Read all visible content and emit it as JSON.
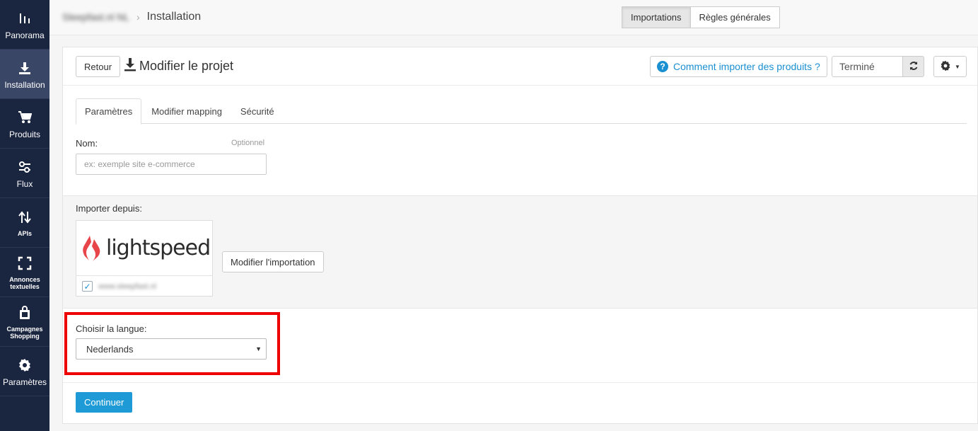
{
  "sidebar": {
    "items": [
      {
        "label": "Panorama",
        "icon": "bar-chart-icon"
      },
      {
        "label": "Installation",
        "icon": "download-icon"
      },
      {
        "label": "Produits",
        "icon": "cart-icon"
      },
      {
        "label": "Flux",
        "icon": "sliders-icon"
      },
      {
        "label": "APIs",
        "icon": "arrows-updown-icon"
      },
      {
        "label": "Annonces textuelles",
        "icon": "expand-icon"
      },
      {
        "label": "Campagnes Shopping",
        "icon": "shopping-bag-icon"
      },
      {
        "label": "Paramètres",
        "icon": "gear-icon"
      }
    ]
  },
  "topbar": {
    "store_name": "Sleepfast.nl NL",
    "page_title": "Installation",
    "segments": [
      "Importations",
      "Règles générales"
    ]
  },
  "header": {
    "back_label": "Retour",
    "title": "Modifier le projet",
    "help_label": "Comment importer des produits ?",
    "status_value": "Terminé"
  },
  "tabs": [
    "Paramètres",
    "Modifier mapping",
    "Sécurité"
  ],
  "form": {
    "name_label": "Nom:",
    "optional_label": "Optionnel",
    "name_placeholder": "ex: exemple site e-commerce"
  },
  "import": {
    "label": "Importer depuis:",
    "source_logo": "lightspeed",
    "source_url": "www.sleepfast.nl",
    "modify_label": "Modifier l'importation"
  },
  "language": {
    "label": "Choisir la langue:",
    "selected": "Nederlands"
  },
  "continue_label": "Continuer",
  "colors": {
    "sidebar_bg": "#1a2540",
    "accent": "#1e9ad6",
    "highlight": "#e00000",
    "brand_red": "#e8454a"
  }
}
